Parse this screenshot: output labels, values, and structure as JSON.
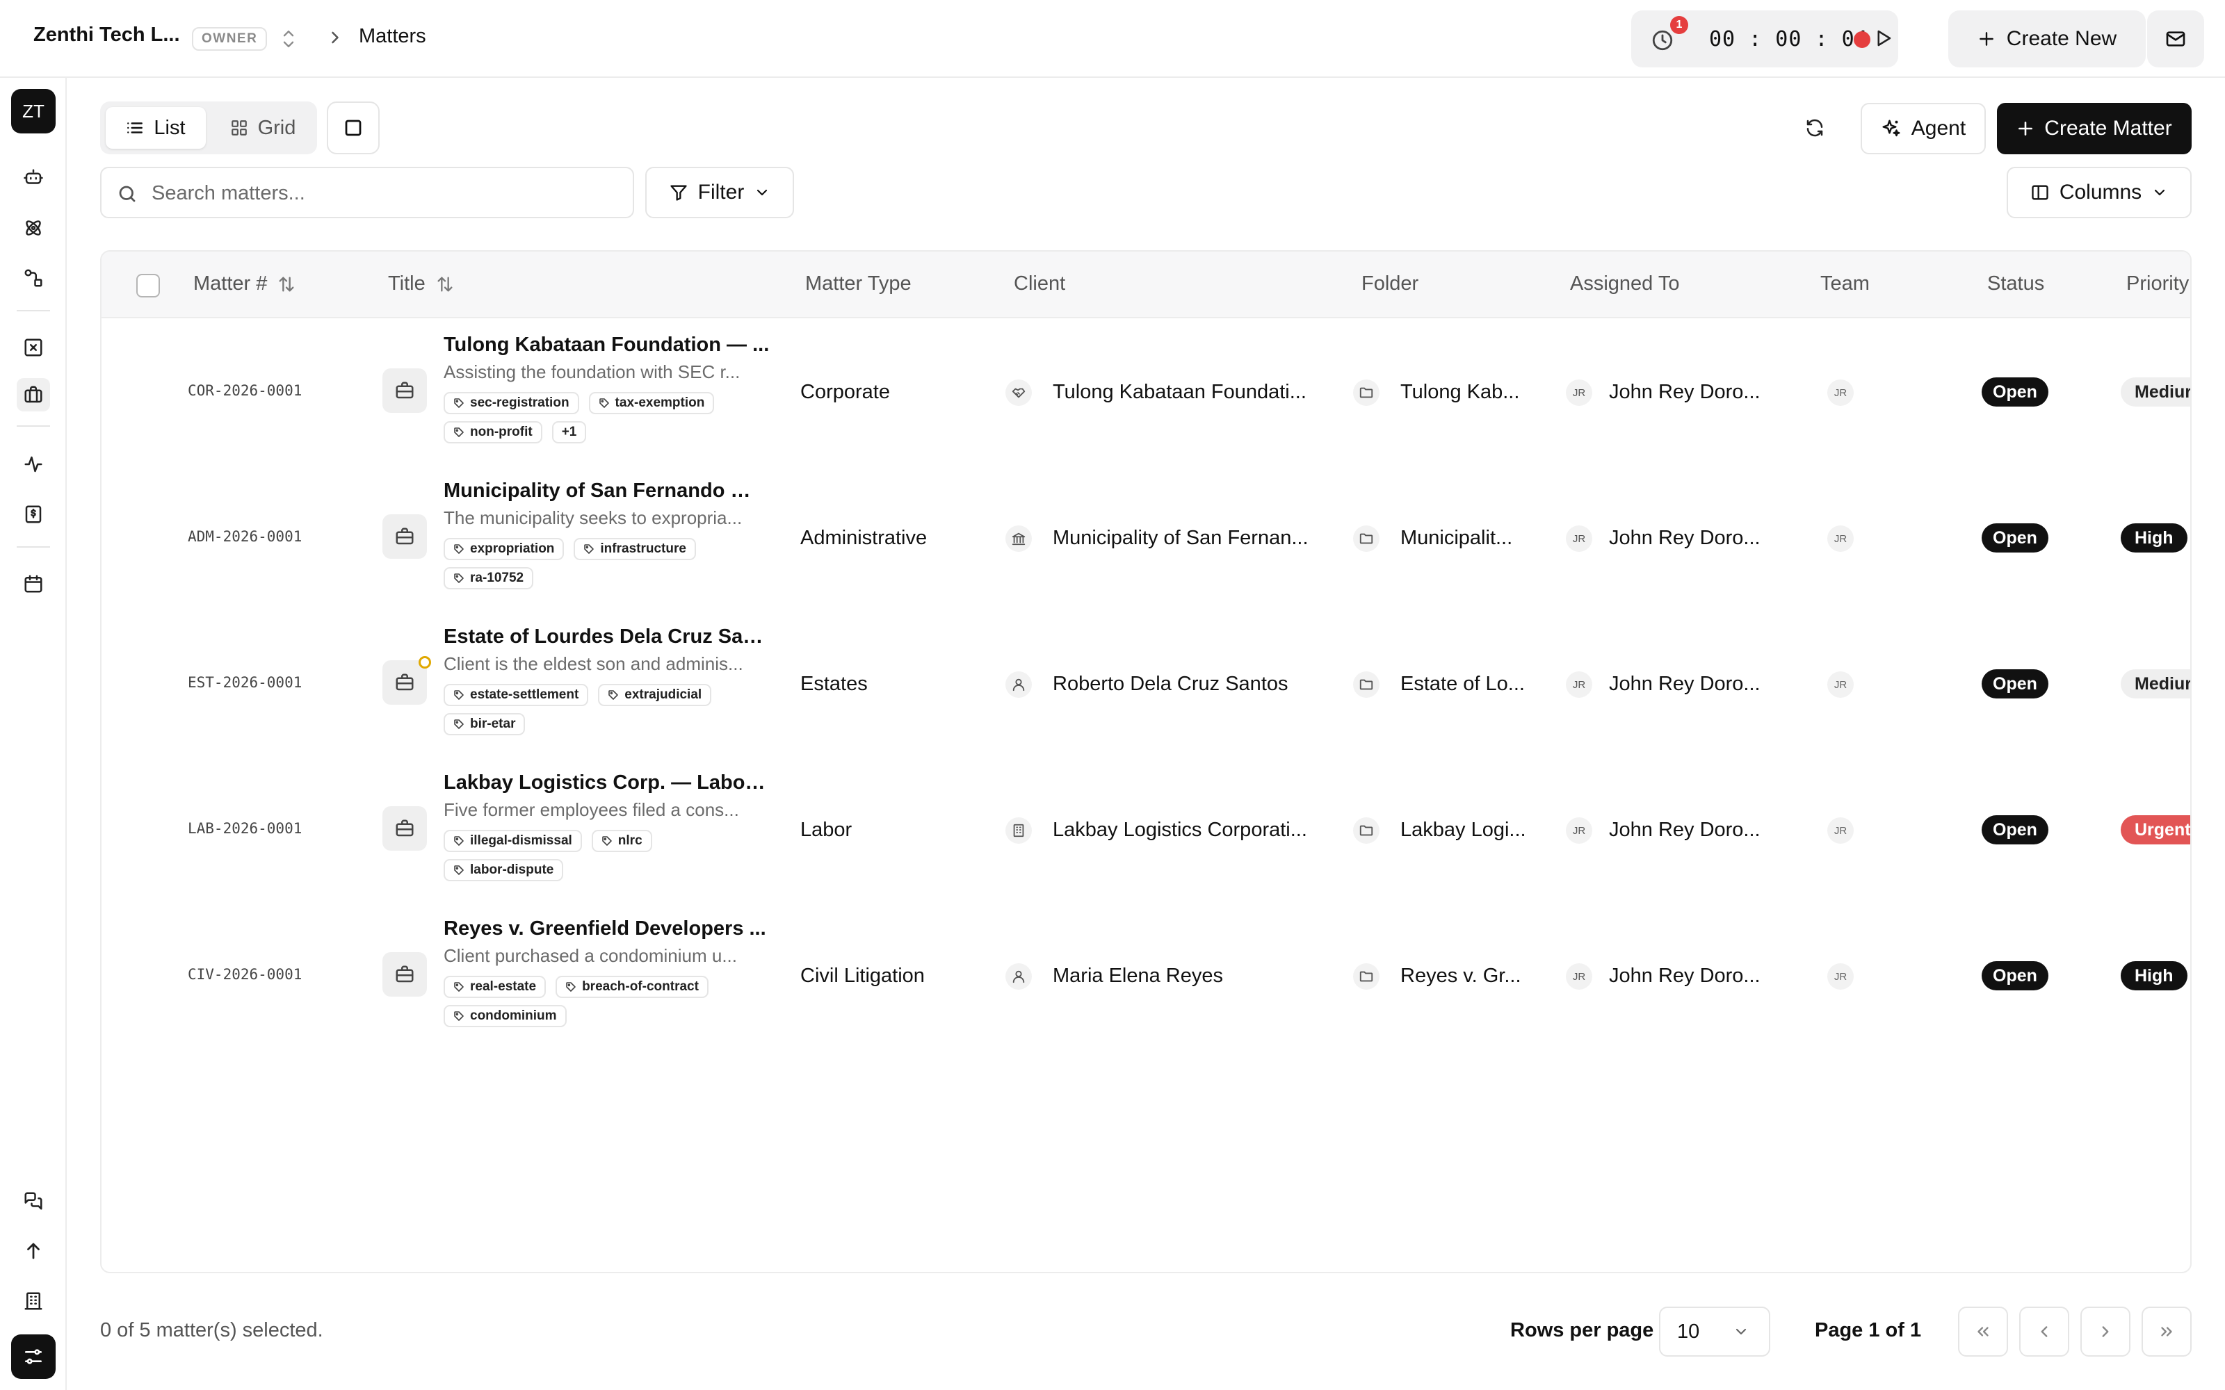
{
  "topbar": {
    "workspace_name": "Zenthi Tech L...",
    "role_badge": "OWNER",
    "breadcrumb": "Matters",
    "timer_badge_count": "1",
    "timer_text": "00 : 00 : 04",
    "create_new_label": "Create New"
  },
  "sidebar": {
    "logo_initials": "ZT",
    "icons": [
      "bot-icon",
      "atom-icon",
      "workflow-icon",
      "square-x-icon",
      "briefcase-icon",
      "activity-icon",
      "dollar-receipt-icon",
      "calendar-icon",
      "chat-icon",
      "arrow-up-icon",
      "building-icon",
      "settings-sliders-icon"
    ]
  },
  "toolbar": {
    "view_list_label": "List",
    "view_grid_label": "Grid",
    "agent_label": "Agent",
    "create_matter_label": "Create Matter",
    "search_placeholder": "Search matters...",
    "filter_label": "Filter",
    "columns_label": "Columns"
  },
  "table": {
    "headers": {
      "matter_num": "Matter #",
      "title": "Title",
      "matter_type": "Matter Type",
      "client": "Client",
      "folder": "Folder",
      "assigned_to": "Assigned To",
      "team": "Team",
      "status": "Status",
      "priority": "Priority"
    },
    "rows": [
      {
        "matter_num": "COR-2026-0001",
        "title": "Tulong Kabataan Foundation — ...",
        "description": "Assisting the foundation with SEC r...",
        "tags": [
          "sec-registration",
          "tax-exemption",
          "non-profit",
          "+1"
        ],
        "matter_type": "Corporate",
        "client_icon": "handshake-icon",
        "client": "Tulong Kabataan Foundati...",
        "folder": "Tulong Kab...",
        "assignee_initials": "JR",
        "assignee": "John Rey Doro...",
        "team_initials": "JR",
        "status": "Open",
        "priority": "Mediur",
        "priority_level": "medium",
        "warning": false
      },
      {
        "matter_num": "ADM-2026-0001",
        "title": "Municipality of San Fernando — ...",
        "description": "The municipality seeks to expropria...",
        "tags": [
          "expropriation",
          "infrastructure",
          "ra-10752"
        ],
        "matter_type": "Administrative",
        "client_icon": "government-building-icon",
        "client": "Municipality of San Fernan...",
        "folder": "Municipalit...",
        "assignee_initials": "JR",
        "assignee": "John Rey Doro...",
        "team_initials": "JR",
        "status": "Open",
        "priority": "High",
        "priority_level": "high",
        "warning": false
      },
      {
        "matter_num": "EST-2026-0001",
        "title": "Estate of Lourdes Dela Cruz San...",
        "description": "Client is the eldest son and adminis...",
        "tags": [
          "estate-settlement",
          "extrajudicial",
          "bir-etar"
        ],
        "matter_type": "Estates",
        "client_icon": "person-icon",
        "client": "Roberto Dela Cruz Santos",
        "folder": "Estate of Lo...",
        "assignee_initials": "JR",
        "assignee": "John Rey Doro...",
        "team_initials": "JR",
        "status": "Open",
        "priority": "Mediur",
        "priority_level": "medium",
        "warning": true
      },
      {
        "matter_num": "LAB-2026-0001",
        "title": "Lakbay Logistics Corp. — Labor ...",
        "description": "Five former employees filed a cons...",
        "tags": [
          "illegal-dismissal",
          "nlrc",
          "labor-dispute"
        ],
        "matter_type": "Labor",
        "client_icon": "office-building-icon",
        "client": "Lakbay Logistics Corporati...",
        "folder": "Lakbay Logi...",
        "assignee_initials": "JR",
        "assignee": "John Rey Doro...",
        "team_initials": "JR",
        "status": "Open",
        "priority": "Urgent",
        "priority_level": "urgent",
        "warning": false
      },
      {
        "matter_num": "CIV-2026-0001",
        "title": "Reyes v. Greenfield Developers ...",
        "description": "Client purchased a condominium u...",
        "tags": [
          "real-estate",
          "breach-of-contract",
          "condominium"
        ],
        "matter_type": "Civil Litigation",
        "client_icon": "person-icon",
        "client": "Maria Elena Reyes",
        "folder": "Reyes v. Gr...",
        "assignee_initials": "JR",
        "assignee": "John Rey Doro...",
        "team_initials": "JR",
        "status": "Open",
        "priority": "High",
        "priority_level": "high",
        "warning": false
      }
    ]
  },
  "footer": {
    "selection_text": "0 of 5 matter(s) selected.",
    "rows_per_page_label": "Rows per page",
    "rows_per_page_value": "10",
    "page_info": "Page 1 of 1"
  }
}
